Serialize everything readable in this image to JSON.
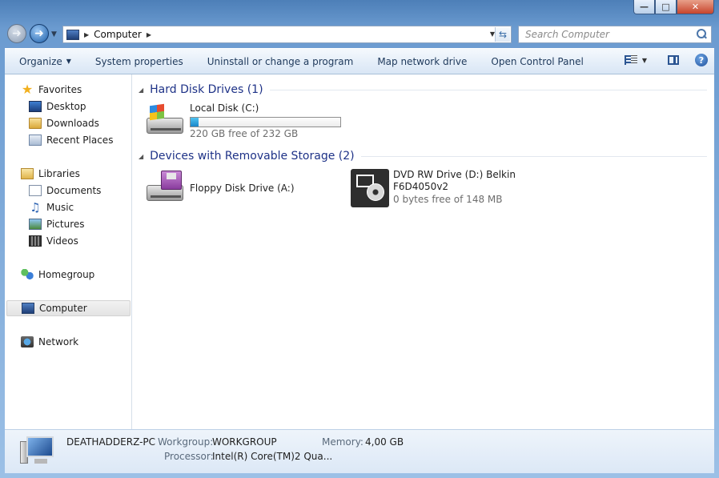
{
  "window": {
    "caption_buttons": {
      "minimize": "—",
      "maximize": "□",
      "close": "✕"
    }
  },
  "nav": {
    "back_icon": "back-arrow-icon",
    "forward_icon": "forward-arrow-icon",
    "forward_glyph": "➜",
    "address_crumb": "Computer",
    "search_placeholder": "Search Computer"
  },
  "toolbar": {
    "organize": "Organize",
    "system_properties": "System properties",
    "uninstall": "Uninstall or change a program",
    "map_drive": "Map network drive",
    "control_panel": "Open Control Panel",
    "help_glyph": "?"
  },
  "sidebar": {
    "favorites": "Favorites",
    "desktop": "Desktop",
    "downloads": "Downloads",
    "recent_places": "Recent Places",
    "libraries": "Libraries",
    "documents": "Documents",
    "music": "Music",
    "pictures": "Pictures",
    "videos": "Videos",
    "homegroup": "Homegroup",
    "computer": "Computer",
    "network": "Network"
  },
  "groups": {
    "hard_disk": {
      "title": "Hard Disk Drives (1)",
      "drives": [
        {
          "name": "Local Disk (C:)",
          "free": "220 GB free of 232 GB",
          "used_fraction": 0.052
        }
      ]
    },
    "removable": {
      "title": "Devices with Removable Storage (2)",
      "drives": [
        {
          "name": "Floppy Disk Drive (A:)"
        },
        {
          "name_line1": "DVD RW Drive (D:) Belkin",
          "name_line2": "F6D4050v2",
          "free": "0 bytes free of 148 MB"
        }
      ]
    }
  },
  "details": {
    "computer_name": "DEATHADDERZ-PC",
    "workgroup_label": "Workgroup:",
    "workgroup_value": "WORKGROUP",
    "memory_label": "Memory:",
    "memory_value": "4,00 GB",
    "processor_label": "Processor:",
    "processor_value": "Intel(R) Core(TM)2 Qua..."
  },
  "colors": {
    "group_header": "#1e3287",
    "progress_fill": "#1a86c9",
    "title_bar": "#6b9bd0"
  }
}
